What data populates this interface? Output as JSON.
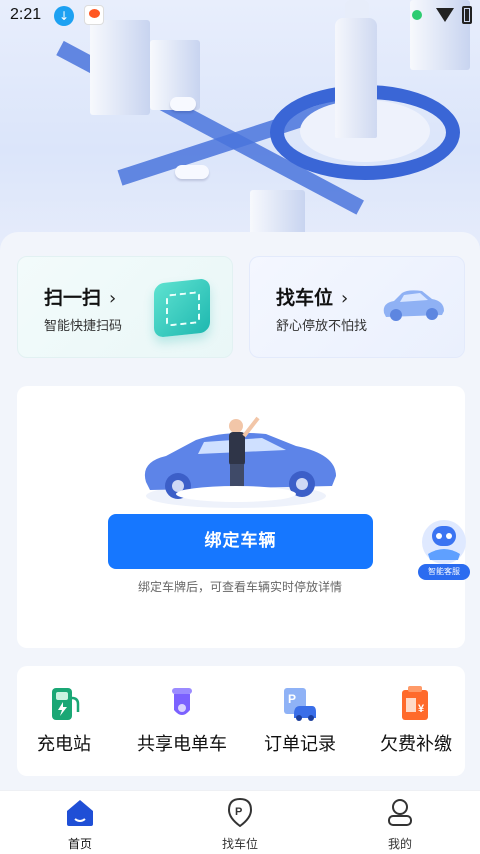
{
  "status_bar": {
    "time": "2:21"
  },
  "quick_cards": [
    {
      "title": "扫一扫",
      "subtitle": "智能快捷扫码"
    },
    {
      "title": "找车位",
      "subtitle": "舒心停放不怕找"
    }
  ],
  "bind": {
    "button_label": "绑定车辆",
    "hint": "绑定车牌后，可查看车辆实时停放详情"
  },
  "service_bot": {
    "label": "智能客服"
  },
  "features": [
    {
      "label": "充电站",
      "icon": "charging-station-icon",
      "color": "#1aa775"
    },
    {
      "label": "共享电单车",
      "icon": "e-bike-icon",
      "color": "#7b61ff"
    },
    {
      "label": "订单记录",
      "icon": "parking-order-icon",
      "color": "#3a6ee8"
    },
    {
      "label": "欠费补缴",
      "icon": "payment-bill-icon",
      "color": "#ff6a2b"
    }
  ],
  "bottom_nav": [
    {
      "label": "首页",
      "icon": "home-icon",
      "active": true
    },
    {
      "label": "找车位",
      "icon": "parking-pin-icon",
      "active": false
    },
    {
      "label": "我的",
      "icon": "profile-icon",
      "active": false
    }
  ],
  "colors": {
    "primary": "#1677ff",
    "nav_active": "#1f4fd6",
    "background": "#f2f5fb"
  }
}
